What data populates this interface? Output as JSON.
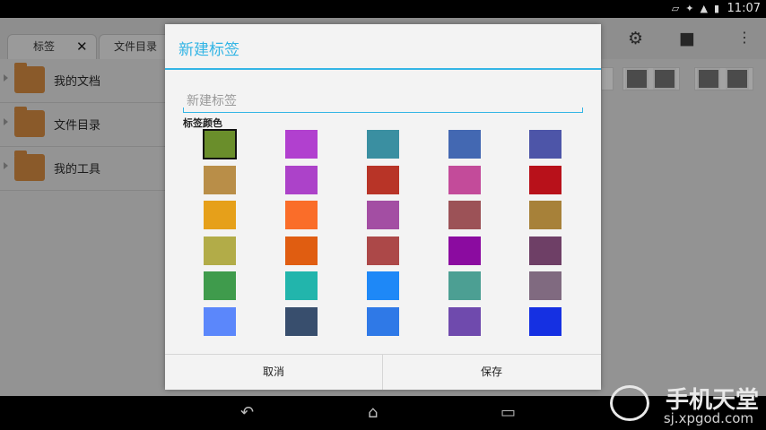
{
  "status_bar": {
    "time": "11:07"
  },
  "tabs": [
    {
      "label": "标签"
    },
    {
      "label": "文件目录"
    }
  ],
  "folders": [
    {
      "label": "我的文档"
    },
    {
      "label": "文件目录"
    },
    {
      "label": "我的工具"
    }
  ],
  "dialog": {
    "title": "新建标签",
    "name_placeholder": "新建标签",
    "color_label": "标签颜色",
    "colors": [
      [
        "#6a8e2b",
        "#b140cf",
        "#3a8fa1",
        "#4368b2",
        "#4d55a8"
      ],
      [
        "#b98e48",
        "#ac42c9",
        "#b83427",
        "#c34b9a",
        "#b8111a"
      ],
      [
        "#e6a01a",
        "#fa6d29",
        "#a34ea3",
        "#9c5257",
        "#a78139"
      ],
      [
        "#b2ac48",
        "#e05d11",
        "#ac4848",
        "#8b0ba0",
        "#6e3f66"
      ],
      [
        "#3f9b4c",
        "#22b5ac",
        "#1e88f7",
        "#4c9f93",
        "#806a80"
      ],
      [
        "#5b87fb",
        "#384e6d",
        "#2f79e7",
        "#6f4aad",
        "#1530e2"
      ]
    ],
    "selected_color": "#6a8e2b",
    "cancel_label": "取消",
    "save_label": "保存"
  },
  "watermark": {
    "title": "手机天堂",
    "url": "sj.xpgod.com"
  }
}
